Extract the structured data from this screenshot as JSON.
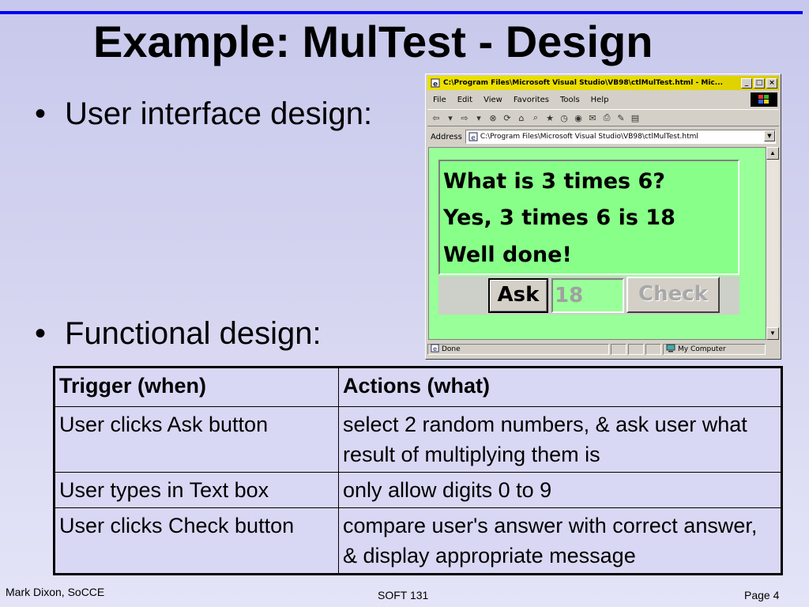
{
  "slide": {
    "title": "Example: MulTest - Design",
    "bullets": [
      "User interface design:",
      "Functional design:"
    ],
    "bullet_char": "•"
  },
  "browser": {
    "title": "C:\\Program Files\\Microsoft Visual Studio\\VB98\\ctlMulTest.html - Mic...",
    "window_buttons": [
      "_",
      "□",
      "×"
    ],
    "menu": [
      "File",
      "Edit",
      "View",
      "Favorites",
      "Tools",
      "Help"
    ],
    "address_label": "Address",
    "address_value": "C:\\Program Files\\Microsoft Visual Studio\\VB98\\ctlMulTest.html",
    "status_text": "Done",
    "status_zone": "My Computer",
    "colors": {
      "titlebar": "#ece000",
      "page_bg": "#99ff99"
    }
  },
  "app": {
    "messages": [
      "What is 3 times 6?",
      "Yes, 3 times 6 is 18",
      "Well done!"
    ],
    "ask_label": "Ask",
    "answer_value": "18",
    "check_label": "Check"
  },
  "table": {
    "headers": [
      "Trigger (when)",
      "Actions (what)"
    ],
    "rows": [
      [
        "User clicks Ask button",
        "select  2 random numbers, & ask user what result of multiplying them is"
      ],
      [
        "User types in Text box",
        "only allow digits 0 to 9"
      ],
      [
        "User clicks Check button",
        "compare user's answer with correct answer, & display appropriate message"
      ]
    ]
  },
  "footer": {
    "author": "Mark Dixon, SoCCE",
    "course": "SOFT 131",
    "page": "Page 4"
  }
}
